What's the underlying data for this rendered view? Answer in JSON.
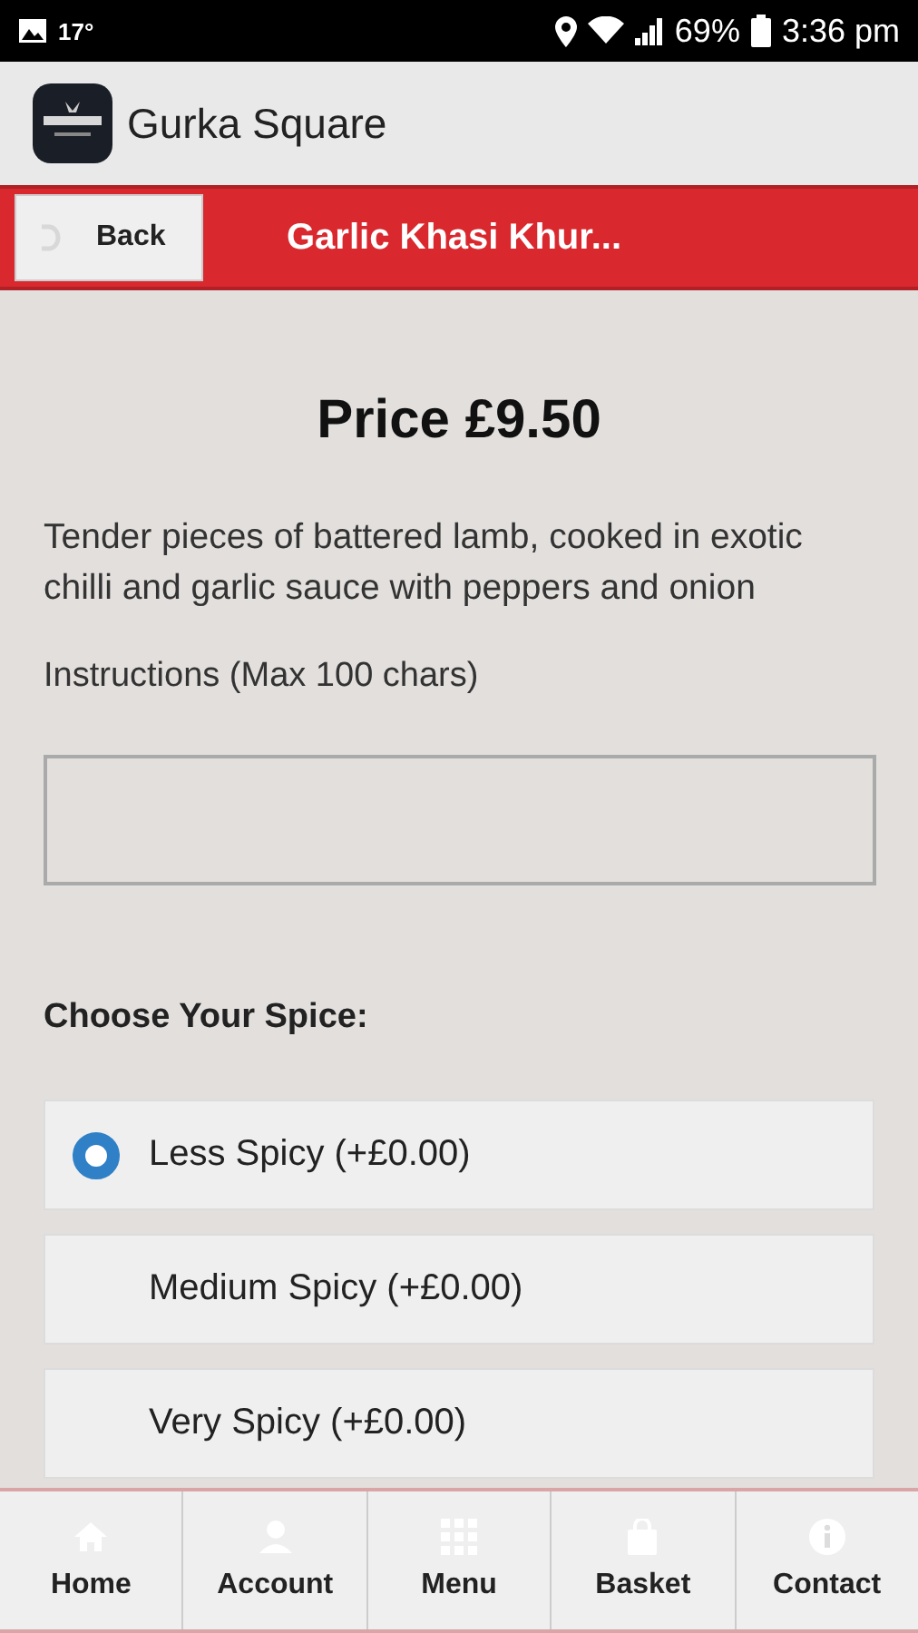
{
  "status_bar": {
    "temperature": "17°",
    "battery": "69%",
    "time": "3:36 pm"
  },
  "app_bar": {
    "title": "Gurka Square"
  },
  "header": {
    "back_label": "Back",
    "title": "Garlic Khasi Khur..."
  },
  "price": "Price £9.50",
  "description": "Tender pieces of battered lamb, cooked in exotic chilli and garlic sauce with peppers and onion",
  "instructions": {
    "label": "Instructions (Max 100 chars)"
  },
  "spice": {
    "heading": "Choose Your Spice:",
    "options": [
      {
        "label": "Less Spicy (+£0.00)",
        "selected": true
      },
      {
        "label": "Medium Spicy (+£0.00)",
        "selected": false
      },
      {
        "label": "Very Spicy (+£0.00)",
        "selected": false
      }
    ]
  },
  "nav": [
    {
      "kind": "home",
      "label": "Home"
    },
    {
      "kind": "account",
      "label": "Account"
    },
    {
      "kind": "menu",
      "label": "Menu"
    },
    {
      "kind": "basket",
      "label": "Basket"
    },
    {
      "kind": "contact",
      "label": "Contact"
    }
  ]
}
